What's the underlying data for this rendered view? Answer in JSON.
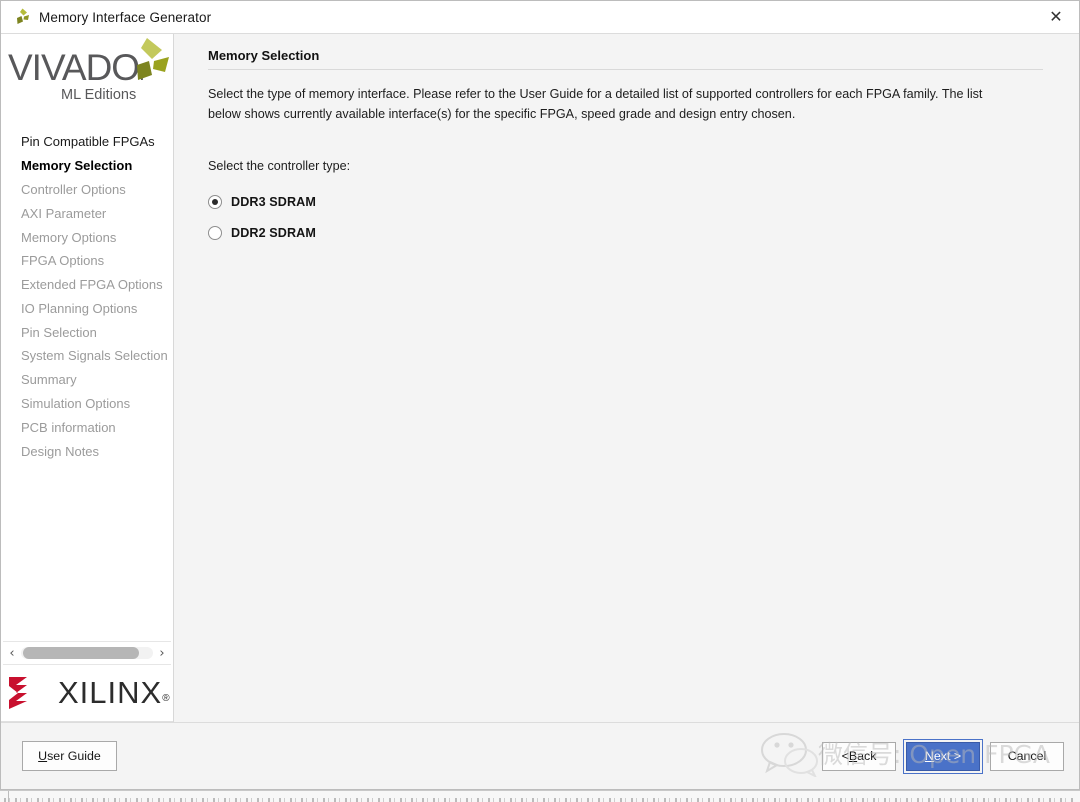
{
  "window": {
    "title": "Memory Interface Generator",
    "app_icon": "vivado-pinwheel-icon",
    "close_icon": "✕"
  },
  "sidebar": {
    "logo": {
      "wordmark": "VIVADO",
      "wordmark_dot": ".",
      "subtitle": "ML Editions"
    },
    "items": [
      {
        "label": "Pin Compatible FPGAs",
        "state": "visited"
      },
      {
        "label": "Memory Selection",
        "state": "active"
      },
      {
        "label": "Controller Options",
        "state": "disabled"
      },
      {
        "label": "AXI Parameter",
        "state": "disabled"
      },
      {
        "label": "Memory Options",
        "state": "disabled"
      },
      {
        "label": "FPGA Options",
        "state": "disabled"
      },
      {
        "label": "Extended FPGA Options",
        "state": "disabled"
      },
      {
        "label": "IO Planning Options",
        "state": "disabled"
      },
      {
        "label": "Pin Selection",
        "state": "disabled"
      },
      {
        "label": "System Signals Selection",
        "state": "disabled"
      },
      {
        "label": "Summary",
        "state": "disabled"
      },
      {
        "label": "Simulation Options",
        "state": "disabled"
      },
      {
        "label": "PCB information",
        "state": "disabled"
      },
      {
        "label": "Design Notes",
        "state": "disabled"
      }
    ],
    "scrollbar": {
      "left_arrow": "‹",
      "right_arrow": "›"
    },
    "vendor_logo": {
      "wordmark": "XILINX",
      "registered": "®"
    }
  },
  "main": {
    "heading": "Memory Selection",
    "description": "Select the type of memory interface. Please refer to the User Guide for a detailed list of supported controllers for each FPGA family. The list below shows currently available interface(s) for the specific FPGA, speed grade and design entry chosen.",
    "controller_label": "Select the controller type:",
    "controller_options": [
      {
        "label": "DDR3 SDRAM",
        "selected": true
      },
      {
        "label": "DDR2 SDRAM",
        "selected": false
      }
    ]
  },
  "footer": {
    "user_guide": {
      "mnemonic": "U",
      "rest": "ser Guide"
    },
    "back": {
      "prefix": "< ",
      "mnemonic": "B",
      "rest": "ack"
    },
    "next": {
      "mnemonic": "N",
      "rest": "ext >"
    },
    "cancel": {
      "label": "Cancel"
    }
  },
  "watermark": {
    "text": "微信号: Open FPGA",
    "icon": "wechat-icon"
  },
  "colors": {
    "accent_blue": "#4a72c8",
    "xilinx_red": "#c8102e",
    "vivado_olive": "#9aa21f",
    "content_bg": "#f4f4f4"
  }
}
